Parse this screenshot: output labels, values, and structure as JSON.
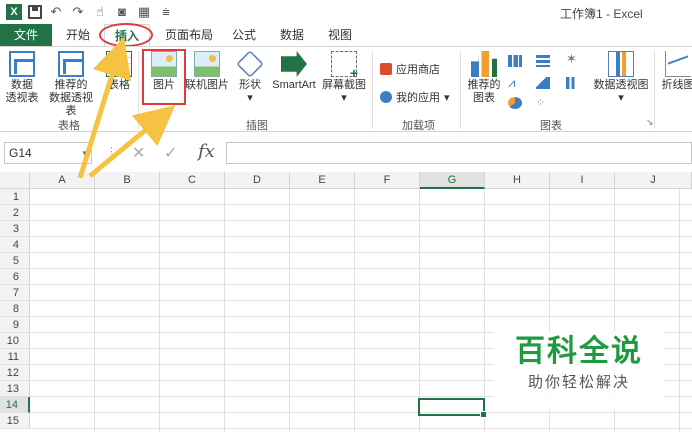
{
  "window": {
    "title": "工作簿1 - Excel",
    "app_logo": "X"
  },
  "qat": {
    "icons": [
      "excel-logo-icon",
      "save-icon",
      "undo-icon",
      "redo-icon",
      "touch-mode-icon",
      "camera-icon",
      "form-icon",
      "customize-icon"
    ]
  },
  "tabs": {
    "file": "文件",
    "items": [
      {
        "label": "开始"
      },
      {
        "label": "插入"
      },
      {
        "label": "页面布局"
      },
      {
        "label": "公式"
      },
      {
        "label": "数据"
      },
      {
        "label": "视图"
      }
    ],
    "active": "插入"
  },
  "ribbon": {
    "groups": {
      "tables": "表格",
      "illustrations": "插图",
      "addins": "加载项",
      "charts": "图表"
    },
    "buttons": {
      "pivot_table_1": "数据",
      "pivot_table_2": "透视表",
      "recommended_pivot_1": "推荐的",
      "recommended_pivot_2": "数据透视表",
      "table": "表格",
      "picture": "图片",
      "online_picture": "联机图片",
      "shapes": "形状",
      "smartart": "SmartArt",
      "screenshot": "屏幕截图",
      "store": "应用商店",
      "my_apps": "我的应用",
      "recommended_charts_1": "推荐的",
      "recommended_charts_2": "图表",
      "pivot_chart": "数据透视图",
      "line_sparkline": "折线图"
    }
  },
  "formula_bar": {
    "name_box": "G14",
    "fx_label": "fx",
    "value": ""
  },
  "sheet": {
    "columns": [
      "A",
      "B",
      "C",
      "D",
      "E",
      "F",
      "G",
      "H",
      "I",
      "J"
    ],
    "rows": [
      "1",
      "2",
      "3",
      "4",
      "5",
      "6",
      "7",
      "8",
      "9",
      "10",
      "11",
      "12",
      "13",
      "14",
      "15"
    ],
    "selected_column": "G",
    "selected_row": "14"
  },
  "watermark": {
    "title": "百科全说",
    "subtitle": "助你轻松解决"
  },
  "colors": {
    "accent": "#217346",
    "highlight": "#e03a3a",
    "arrow": "#f5c242"
  }
}
